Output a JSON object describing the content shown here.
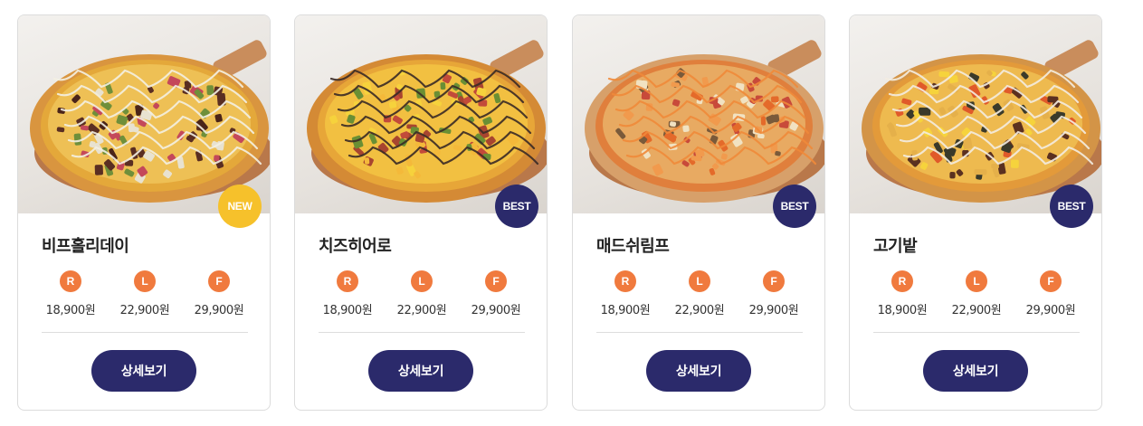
{
  "products": [
    {
      "name": "비프홀리데이",
      "badge": "NEW",
      "badge_type": "new",
      "pizza_theme": "beef-holiday",
      "prices": [
        {
          "size": "R",
          "price": "18,900원"
        },
        {
          "size": "L",
          "price": "22,900원"
        },
        {
          "size": "F",
          "price": "29,900원"
        }
      ],
      "button_label": "상세보기"
    },
    {
      "name": "치즈히어로",
      "badge": "BEST",
      "badge_type": "best",
      "pizza_theme": "cheese-hero",
      "prices": [
        {
          "size": "R",
          "price": "18,900원"
        },
        {
          "size": "L",
          "price": "22,900원"
        },
        {
          "size": "F",
          "price": "29,900원"
        }
      ],
      "button_label": "상세보기"
    },
    {
      "name": "매드쉬림프",
      "badge": "BEST",
      "badge_type": "best",
      "pizza_theme": "mad-shrimp",
      "prices": [
        {
          "size": "R",
          "price": "18,900원"
        },
        {
          "size": "L",
          "price": "22,900원"
        },
        {
          "size": "F",
          "price": "29,900원"
        }
      ],
      "button_label": "상세보기"
    },
    {
      "name": "고기밭",
      "badge": "BEST",
      "badge_type": "best",
      "pizza_theme": "meat-field",
      "prices": [
        {
          "size": "R",
          "price": "18,900원"
        },
        {
          "size": "L",
          "price": "22,900원"
        },
        {
          "size": "F",
          "price": "29,900원"
        }
      ],
      "button_label": "상세보기"
    }
  ],
  "colors": {
    "badge_new": "#f6c12b",
    "badge_best": "#2b2a6b",
    "size_chip": "#f07a3e",
    "button": "#2b2a6b"
  }
}
